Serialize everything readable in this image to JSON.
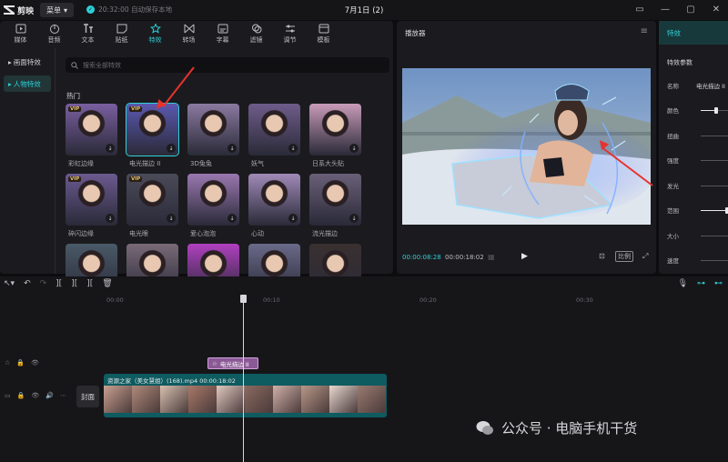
{
  "app": {
    "logo": "剪映",
    "menu_label": "菜单",
    "autosave": "20:32:00 自动保存本地",
    "doc_title": "7月1日 (2)"
  },
  "toolbar": [
    {
      "label": "媒体",
      "icon": "media-icon"
    },
    {
      "label": "音频",
      "icon": "audio-icon"
    },
    {
      "label": "文本",
      "icon": "text-icon"
    },
    {
      "label": "贴纸",
      "icon": "sticker-icon"
    },
    {
      "label": "特效",
      "icon": "effects-icon"
    },
    {
      "label": "转场",
      "icon": "transition-icon"
    },
    {
      "label": "字幕",
      "icon": "caption-icon"
    },
    {
      "label": "滤镜",
      "icon": "filter-icon"
    },
    {
      "label": "调节",
      "icon": "adjust-icon"
    },
    {
      "label": "模板",
      "icon": "template-icon"
    }
  ],
  "subnav": [
    {
      "label": "画面特效"
    },
    {
      "label": "人物特效"
    }
  ],
  "search": {
    "placeholder": "搜索全部特效"
  },
  "section": {
    "hot": "热门"
  },
  "effects": [
    {
      "label": "彩虹边缘",
      "vip": "VIP",
      "color": "#7a5fa0"
    },
    {
      "label": "电光描边 II",
      "vip": "VIP",
      "color": "#5b58b0"
    },
    {
      "label": "3D兔兔",
      "vip": "",
      "color": "#8b7aa0"
    },
    {
      "label": "妖气",
      "vip": "",
      "color": "#6e5c8a"
    },
    {
      "label": "日系大头贴",
      "vip": "",
      "color": "#c89bb8"
    },
    {
      "label": "碎闪边缘",
      "vip": "VIP",
      "color": "#6b5a90"
    },
    {
      "label": "电光眼",
      "vip": "VIP",
      "color": "#4a4a58"
    },
    {
      "label": "爱心泡泡",
      "vip": "",
      "color": "#9a78b0"
    },
    {
      "label": "心动",
      "vip": "",
      "color": "#a08ab8"
    },
    {
      "label": "流光描边",
      "vip": "",
      "color": "#6a6078"
    },
    {
      "label": "",
      "vip": "",
      "color": "#4a5a68"
    },
    {
      "label": "",
      "vip": "",
      "color": "#7a6a78"
    },
    {
      "label": "",
      "vip": "",
      "color": "#b040c0"
    },
    {
      "label": "",
      "vip": "",
      "color": "#6a6a8a"
    },
    {
      "label": "",
      "vip": "",
      "color": "#3a3030"
    }
  ],
  "player": {
    "title": "播放器",
    "current_time": "00:00:08:28",
    "total_time": "00:00:18:02",
    "ratio": "比例"
  },
  "right_panel": {
    "title": "特效",
    "subtitle": "特效参数",
    "name_label": "名称",
    "name_value": "电光描边 II",
    "params": [
      {
        "label": "颜色",
        "level": 0.55
      },
      {
        "label": "扭曲",
        "level": null
      },
      {
        "label": "强度",
        "level": null
      },
      {
        "label": "发光",
        "level": null
      },
      {
        "label": "范围",
        "level": 0.95
      },
      {
        "label": "大小",
        "level": null
      },
      {
        "label": "速度",
        "level": null
      }
    ]
  },
  "timeline": {
    "ticks": [
      "00:00",
      "00:10",
      "00:20",
      "00:30"
    ],
    "effect_clip": "电光描边 II",
    "video_clip": "资源之家（美女慧姐）(168).mp4  00:00:18:02",
    "cover": "封面"
  },
  "watermark": "公众号 · 电脑手机干货",
  "colors": {
    "accent": "#2ed0d8",
    "arrow": "#e8322c"
  }
}
